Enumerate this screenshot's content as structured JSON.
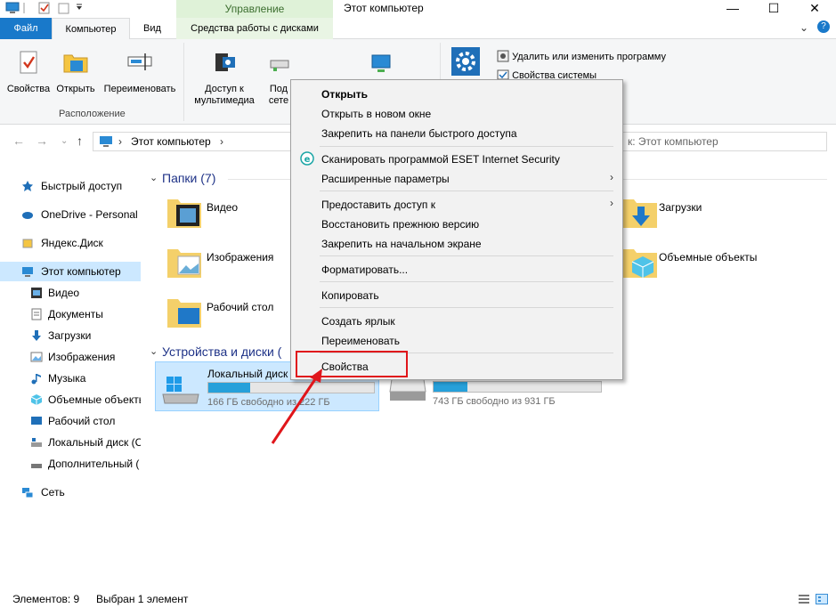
{
  "window": {
    "title": "Этот компьютер",
    "minimize": "—",
    "maximize": "☐",
    "close": "✕",
    "help": "?",
    "collapse": "⌄"
  },
  "ribbon_tabs": {
    "file": "Файл",
    "computer": "Компьютер",
    "view": "Вид",
    "manage": "Управление",
    "drive_tools": "Средства работы с дисками"
  },
  "ribbon": {
    "properties": "Свойства",
    "open": "Открыть",
    "rename": "Переименовать",
    "group_location": "Расположение",
    "media_access_line1": "Доступ к",
    "media_access_line2": "мультимедиа",
    "network_line1": "Под",
    "network_line2": "сете",
    "uninstall": "Удалить или изменить программу",
    "system_props": "Свойства системы"
  },
  "nav": {
    "address": "Этот компьютер",
    "search_placeholder": "к: Этот компьютер"
  },
  "sidebar": {
    "items": [
      {
        "label": "Быстрый доступ"
      },
      {
        "label": "OneDrive - Personal"
      },
      {
        "label": "Яндекс.Диск"
      },
      {
        "label": "Этот компьютер"
      },
      {
        "label": "Видео"
      },
      {
        "label": "Документы"
      },
      {
        "label": "Загрузки"
      },
      {
        "label": "Изображения"
      },
      {
        "label": "Музыка"
      },
      {
        "label": "Объемные объекты"
      },
      {
        "label": "Рабочий стол"
      },
      {
        "label": "Локальный диск (C"
      },
      {
        "label": "Дополнительный ("
      },
      {
        "label": "Сеть"
      }
    ]
  },
  "content": {
    "folders_header": "Папки (7)",
    "folders": [
      {
        "label": "Видео"
      },
      {
        "label": "Изображения"
      },
      {
        "label": "Рабочий стол"
      },
      {
        "label": "Загрузки"
      },
      {
        "label": "Объемные объекты"
      }
    ],
    "devices_header": "Устройства и диски (",
    "drives": [
      {
        "label": "Локальный диск",
        "free_text": "166 ГБ свободно из 222 ГБ",
        "used_fraction": 0.25
      },
      {
        "label": "",
        "free_text": "743 ГБ свободно из 931 ГБ",
        "used_fraction": 0.2
      }
    ]
  },
  "context_menu": {
    "open": "Открыть",
    "open_new_window": "Открыть в новом окне",
    "pin_quick": "Закрепить на панели быстрого доступа",
    "eset_scan": "Сканировать программой ESET Internet Security",
    "advanced": "Расширенные параметры",
    "share": "Предоставить доступ к",
    "restore": "Восстановить прежнюю версию",
    "pin_start": "Закрепить на начальном экране",
    "format": "Форматировать...",
    "copy": "Копировать",
    "shortcut": "Создать ярлык",
    "rename": "Переименовать",
    "properties": "Свойства"
  },
  "status": {
    "items_count": "Элементов: 9",
    "selected": "Выбран 1 элемент"
  },
  "colors": {
    "accent": "#1979ca",
    "highlight_red": "#e0161b",
    "selection": "#cce8ff"
  }
}
